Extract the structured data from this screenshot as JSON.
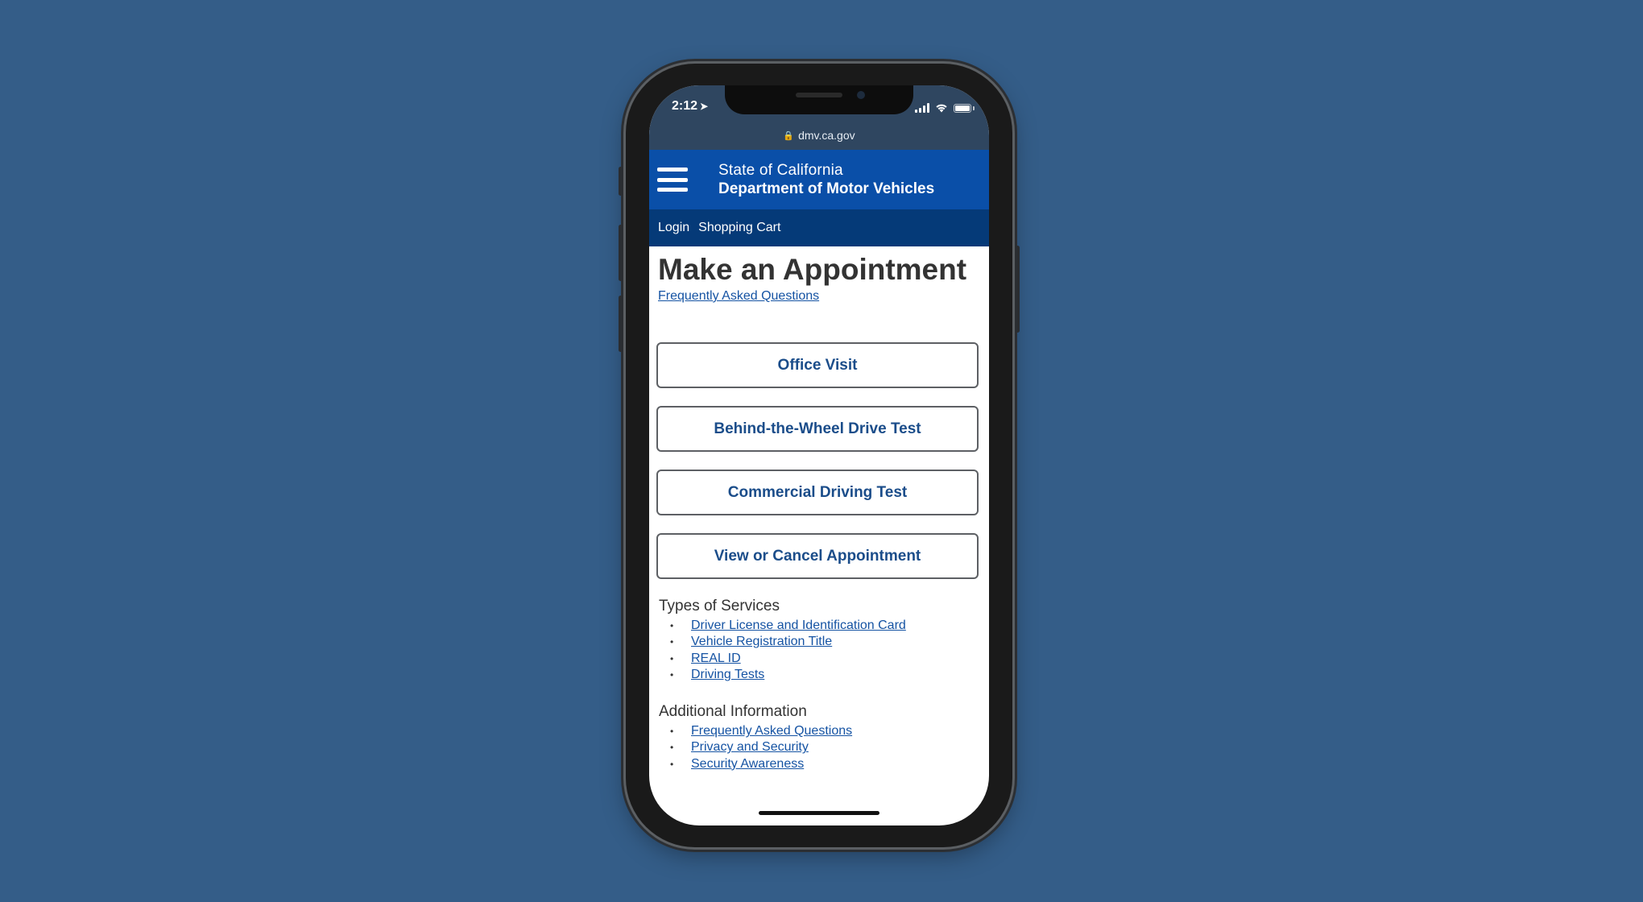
{
  "status_bar": {
    "time": "2:12",
    "location_arrow": "location-arrow-icon"
  },
  "browser": {
    "url": "dmv.ca.gov"
  },
  "header": {
    "brand_line1": "State of California",
    "brand_line2": "Department of Motor Vehicles",
    "menu_icon": "hamburger-menu-icon"
  },
  "subnav": {
    "login": "Login",
    "cart": "Shopping Cart"
  },
  "main": {
    "title": "Make an Appointment",
    "faq_link": "Frequently Asked Questions",
    "buttons": [
      "Office Visit",
      "Behind-the-Wheel Drive Test",
      "Commercial Driving Test",
      "View or Cancel Appointment"
    ]
  },
  "services": {
    "title": "Types of Services",
    "links": [
      "Driver License and Identification Card",
      "Vehicle Registration Title",
      "REAL ID",
      "Driving Tests"
    ]
  },
  "additional": {
    "title": "Additional Information",
    "links": [
      "Frequently Asked Questions",
      "Privacy and Security",
      "Security Awareness"
    ]
  },
  "colors": {
    "background": "#345d88",
    "header_blue": "#0a4fa8",
    "subnav_blue": "#053a78",
    "link_blue": "#1553a3",
    "button_text": "#1b4d8a"
  }
}
